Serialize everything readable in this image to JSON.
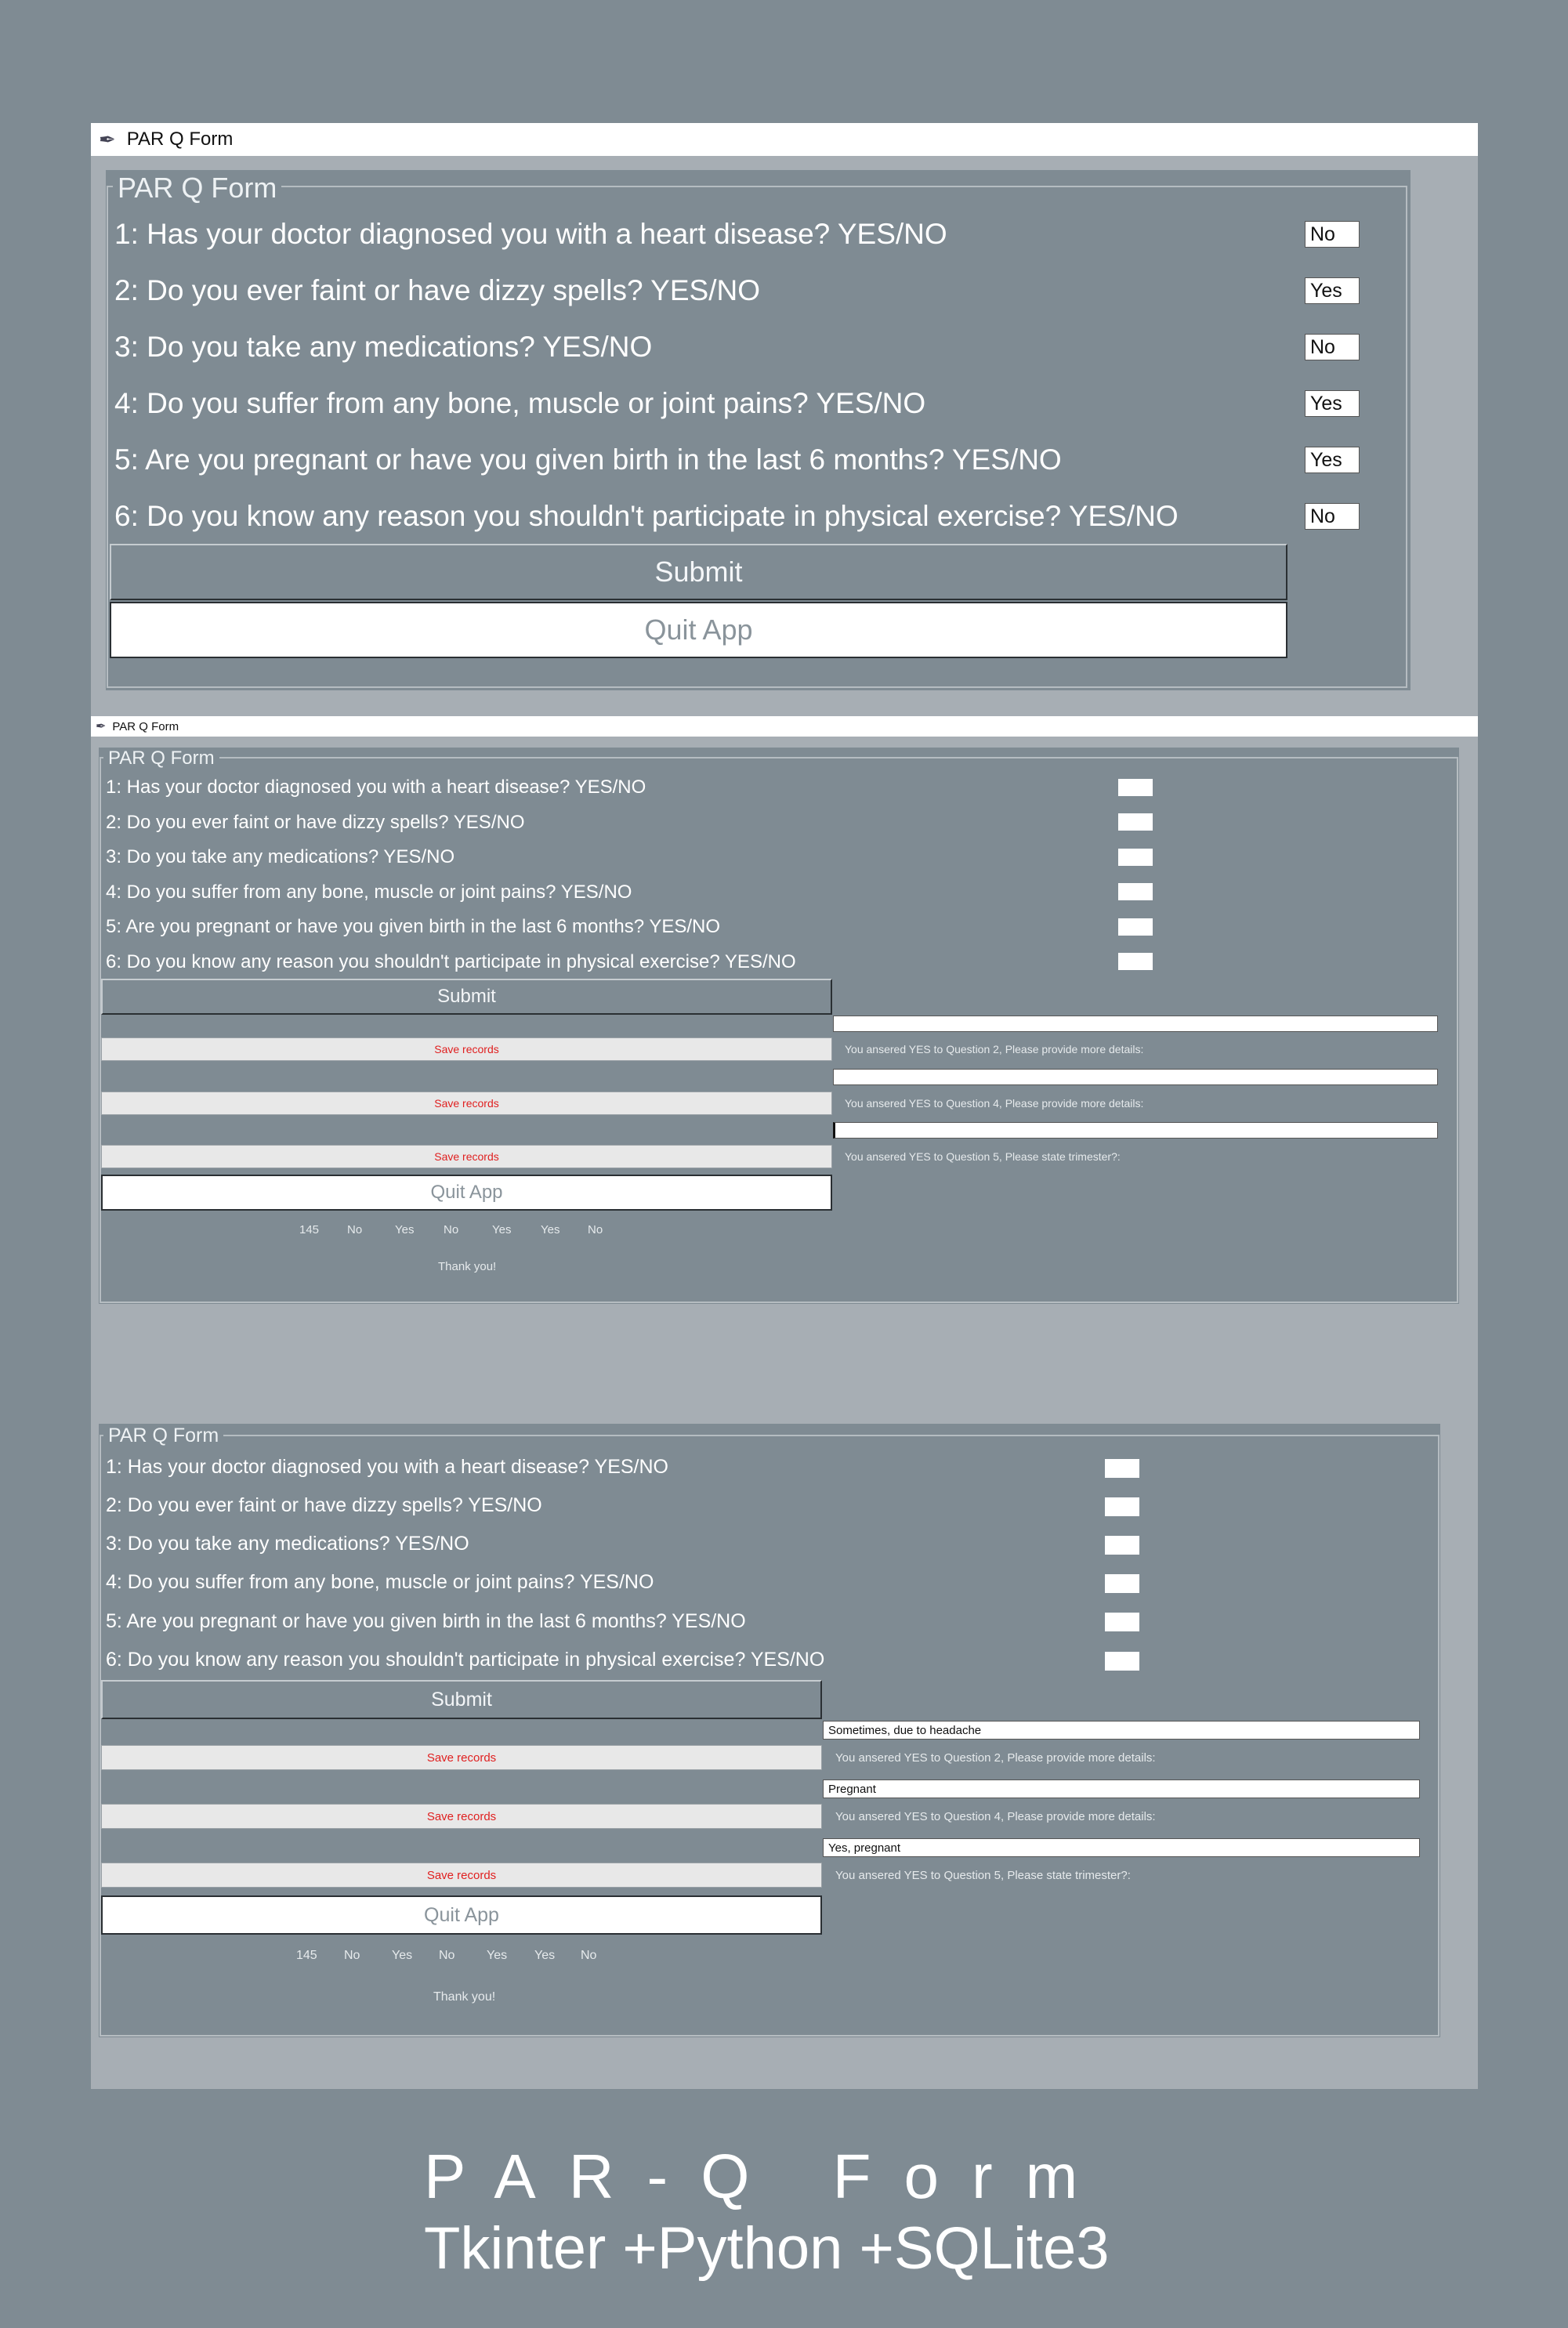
{
  "window1": {
    "title": "PAR Q Form",
    "group_title": "PAR Q Form",
    "questions": [
      "1: Has your doctor diagnosed you with a heart disease? YES/NO",
      "2: Do you ever faint or have dizzy spells? YES/NO",
      "3: Do you take any medications? YES/NO",
      "4: Do you suffer from any bone, muscle or joint pains? YES/NO",
      "5: Are you pregnant or have you given birth in the last 6 months? YES/NO",
      "6: Do you know any reason you shouldn't participate in physical exercise? YES/NO"
    ],
    "answers": [
      "No",
      "Yes",
      "No",
      "Yes",
      "Yes",
      "No"
    ],
    "submit_label": "Submit",
    "quit_label": "Quit App"
  },
  "window2": {
    "title": "PAR Q Form",
    "group_title": "PAR Q Form",
    "questions": [
      "1: Has your doctor diagnosed you with a heart disease? YES/NO",
      "2: Do you ever faint or have dizzy spells? YES/NO",
      "3: Do you take any medications? YES/NO",
      "4: Do you suffer from any bone, muscle or joint pains? YES/NO",
      "5: Are you pregnant or have you given birth in the last 6 months? YES/NO",
      "6: Do you know any reason you shouldn't participate in physical exercise? YES/NO"
    ],
    "answers": [
      "",
      "",
      "",
      "",
      "",
      ""
    ],
    "submit_label": "Submit",
    "save_label": "Save records",
    "detail_values": [
      "",
      "",
      ""
    ],
    "prompts": [
      "You ansered YES to Question 2, Please provide more details:",
      "You ansered YES to Question 4, Please provide more details:",
      "You ansered YES to Question 5, Please state trimester?:"
    ],
    "quit_label": "Quit App",
    "record": [
      "145",
      "No",
      "Yes",
      "No",
      "Yes",
      "Yes",
      "No"
    ],
    "thanks": "Thank you!"
  },
  "window3": {
    "group_title": "PAR Q Form",
    "questions": [
      "1: Has your doctor diagnosed you with a heart disease? YES/NO",
      "2: Do you ever faint or have dizzy spells? YES/NO",
      "3: Do you take any medications? YES/NO",
      "4: Do you suffer from any bone, muscle or joint pains? YES/NO",
      "5: Are you pregnant or have you given birth in the last 6 months? YES/NO",
      "6: Do you know any reason you shouldn't participate in physical exercise? YES/NO"
    ],
    "answers": [
      "",
      "",
      "",
      "",
      "",
      ""
    ],
    "submit_label": "Submit",
    "save_label": "Save records",
    "detail_values": [
      "Sometimes, due to headache",
      "Pregnant",
      "Yes, pregnant"
    ],
    "prompts": [
      "You ansered YES to Question 2, Please provide more details:",
      "You ansered YES to Question 4, Please provide more details:",
      "You ansered YES to Question 5, Please state trimester?:"
    ],
    "quit_label": "Quit App",
    "record": [
      "145",
      "No",
      "Yes",
      "No",
      "Yes",
      "Yes",
      "No"
    ],
    "thanks": "Thank you!"
  },
  "footer": {
    "line1": "PAR-Q Form",
    "line2": "Tkinter +Python +SQLite3"
  }
}
